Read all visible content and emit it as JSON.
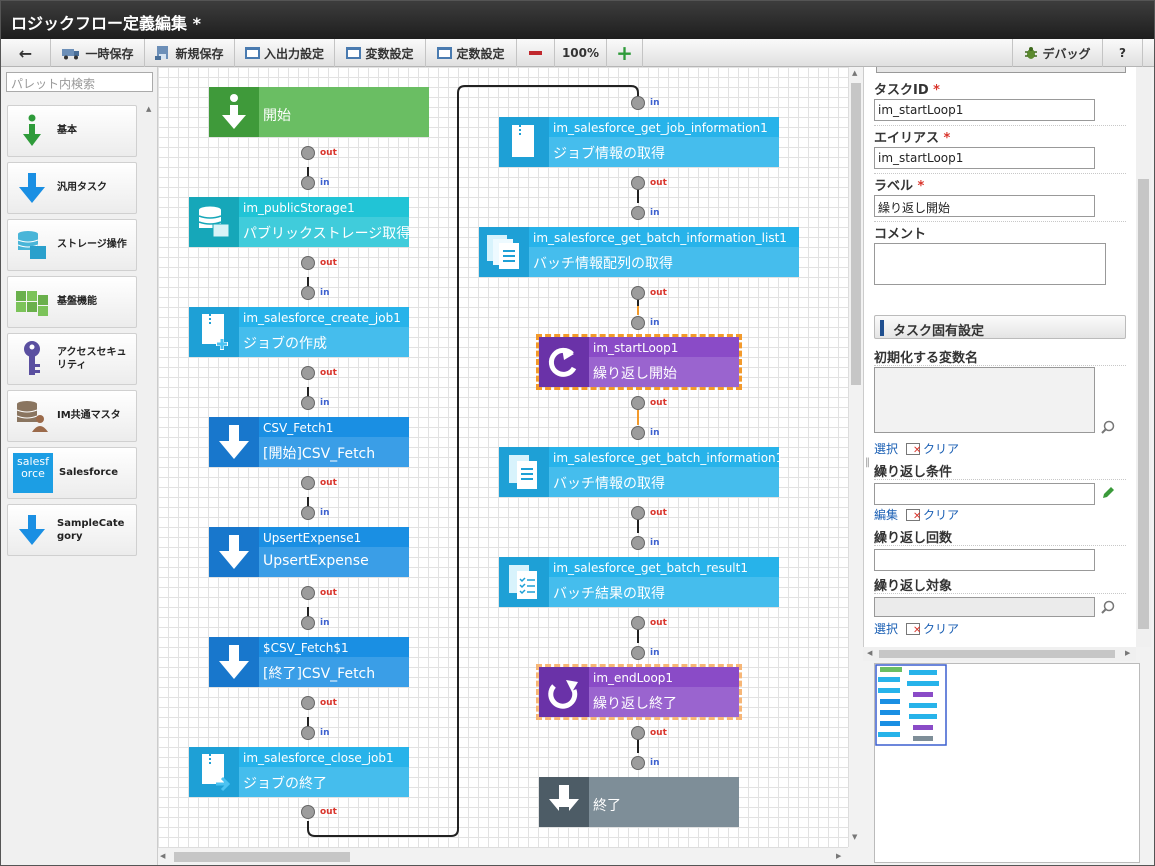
{
  "window": {
    "title": "ロジックフロー定義編集 *"
  },
  "toolbar": {
    "back": "←",
    "save_temp": "一時保存",
    "save_new": "新規保存",
    "io_settings": "入出力設定",
    "var_settings": "変数設定",
    "const_settings": "定数設定",
    "zoom": "100%",
    "debug": "デバッグ",
    "help": "?"
  },
  "palette": {
    "search_placeholder": "パレット内検索",
    "items": [
      {
        "label": "基本"
      },
      {
        "label": "汎用タスク"
      },
      {
        "label": "ストレージ操作"
      },
      {
        "label": "基盤機能"
      },
      {
        "label": "アクセスセキュリティ"
      },
      {
        "label": "IM共通マスタ"
      },
      {
        "label": "Salesforce"
      },
      {
        "label": "SampleCategory"
      }
    ],
    "salesforce_logo": "salesforce"
  },
  "ports": {
    "out": "out",
    "in": "in"
  },
  "nodes": {
    "start": {
      "body": "開始"
    },
    "public_storage": {
      "id": "im_publicStorage1",
      "body": "パブリックストレージ取得"
    },
    "create_job": {
      "id": "im_salesforce_create_job1",
      "body": "ジョブの作成"
    },
    "csv_fetch": {
      "id": "CSV_Fetch1",
      "body": "[開始]CSV_Fetch"
    },
    "upsert": {
      "id": "UpsertExpense1",
      "body": "UpsertExpense"
    },
    "csv_fetch_end": {
      "id": "$CSV_Fetch$1",
      "body": "[終了]CSV_Fetch"
    },
    "close_job": {
      "id": "im_salesforce_close_job1",
      "body": "ジョブの終了"
    },
    "get_job_info": {
      "id": "im_salesforce_get_job_information1",
      "body": "ジョブ情報の取得"
    },
    "get_batch_list": {
      "id": "im_salesforce_get_batch_information_list1",
      "body": "バッチ情報配列の取得"
    },
    "start_loop": {
      "id": "im_startLoop1",
      "body": "繰り返し開始"
    },
    "get_batch_info": {
      "id": "im_salesforce_get_batch_information1",
      "body": "バッチ情報の取得"
    },
    "get_batch_result": {
      "id": "im_salesforce_get_batch_result1",
      "body": "バッチ結果の取得"
    },
    "end_loop": {
      "id": "im_endLoop1",
      "body": "繰り返し終了"
    },
    "end": {
      "body": "終了"
    }
  },
  "props": {
    "task_id_label": "タスクID",
    "task_id_value": "im_startLoop1",
    "alias_label": "エイリアス",
    "alias_value": "im_startLoop1",
    "label_label": "ラベル",
    "label_value": "繰り返し開始",
    "comment_label": "コメント",
    "section_title": "タスク固有設定",
    "init_var_label": "初期化する変数名",
    "select": "選択",
    "clear": "クリア",
    "edit": "編集",
    "loop_cond_label": "繰り返し条件",
    "loop_count_label": "繰り返し回数",
    "loop_target_label": "繰り返し対象",
    "required_mark": "*"
  },
  "colors": {
    "titlebar": "#2b2b2b",
    "node_blue": "#27b3ea",
    "start_green": "#6abe63",
    "loop_purple": "#8a4bc7",
    "end_gray": "#7e8e98",
    "out_port": "#d9342b",
    "in_port": "#3b5fcf"
  }
}
